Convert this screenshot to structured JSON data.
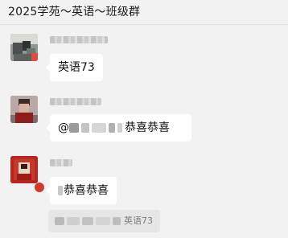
{
  "header": {
    "title": "2025学苑～英语～班级群"
  },
  "messages": [
    {
      "text": "英语73"
    },
    {
      "mention": "@",
      "text": "恭喜恭喜"
    },
    {
      "text": "恭喜恭喜",
      "quote": {
        "text": "英语73"
      }
    }
  ],
  "colors": {
    "background": "#f2f2f2",
    "bubble": "#ffffff",
    "quote_bg": "#e6e6e6",
    "text": "#111111"
  },
  "icons": {
    "avatar_1": "avatar-image",
    "avatar_2": "avatar-image",
    "avatar_3": "avatar-image"
  }
}
